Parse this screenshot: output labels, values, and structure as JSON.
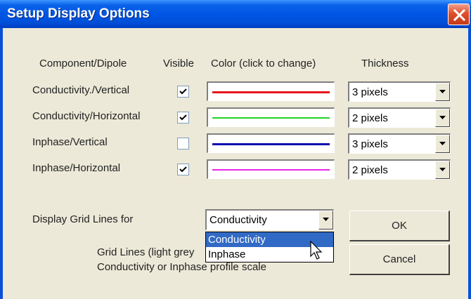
{
  "window": {
    "title": "Setup Display Options"
  },
  "headers": {
    "component": "Component/Dipole",
    "visible": "Visible",
    "color": "Color (click to change)",
    "thickness": "Thickness"
  },
  "rows": [
    {
      "label": "Conductivity./Vertical",
      "visible": true,
      "color": "#e8151b",
      "thickness": "3 pixels"
    },
    {
      "label": "Conductivity/Horizontal",
      "visible": true,
      "color": "#22d422",
      "thickness": "2 pixels"
    },
    {
      "label": "Inphase/Vertical",
      "visible": false,
      "color": "#0d0db0",
      "thickness": "3 pixels"
    },
    {
      "label": "Inphase/Horizontal",
      "visible": true,
      "color": "#e825e8",
      "thickness": "2 pixels"
    }
  ],
  "grid": {
    "label": "Display Grid Lines for",
    "selected": "Conductivity",
    "options": [
      "Conductivity",
      "Inphase"
    ],
    "note_line1": "Grid Lines (light grey",
    "note_line2": "Conductivity or Inphase profile scale"
  },
  "buttons": {
    "ok": "OK",
    "cancel": "Cancel"
  }
}
